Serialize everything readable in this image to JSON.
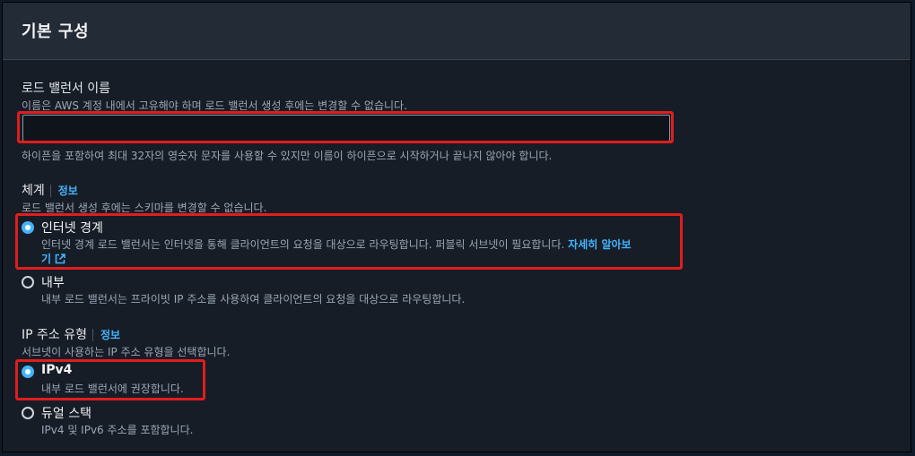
{
  "section": {
    "title": "기본 구성"
  },
  "lb_name": {
    "label": "로드 밸런서 이름",
    "description": "이름은 AWS 계정 내에서 고유해야 하며 로드 밸런서 생성 후에는 변경할 수 없습니다.",
    "value": "",
    "placeholder": "",
    "hint": "하이픈을 포함하여 최대 32자의 영숫자 문자를 사용할 수 있지만 이름이 하이픈으로 시작하거나 끝나지 않아야 합니다."
  },
  "scheme": {
    "label": "체계",
    "info": "정보",
    "description": "로드 밸런서 생성 후에는 스키마를 변경할 수 없습니다.",
    "options": [
      {
        "label": "인터넷 경계",
        "description": "인터넷 경계 로드 밸런서는 인터넷을 통해 클라이언트의 요청을 대상으로 라우팅합니다. 퍼블릭 서브넷이 필요합니다.",
        "link_part1": "자세히 알아보",
        "link_part2": "기",
        "selected": true
      },
      {
        "label": "내부",
        "description": "내부 로드 밸런서는 프라이빗 IP 주소를 사용하여 클라이언트의 요청을 대상으로 라우팅합니다.",
        "selected": false
      }
    ]
  },
  "ip_type": {
    "label": "IP 주소 유형",
    "info": "정보",
    "description": "서브넷이 사용하는 IP 주소 유형을 선택합니다.",
    "options": [
      {
        "label": "IPv4",
        "description": "내부 로드 밸런서에 권장합니다.",
        "selected": true
      },
      {
        "label": "듀얼 스택",
        "description": "IPv4 및 IPv6 주소를 포함합니다.",
        "selected": false
      }
    ]
  },
  "colors": {
    "accent": "#42b4ff",
    "highlight": "#e11d1d",
    "background": "#161d26"
  },
  "icons": {
    "external_link": "external-link-icon"
  }
}
